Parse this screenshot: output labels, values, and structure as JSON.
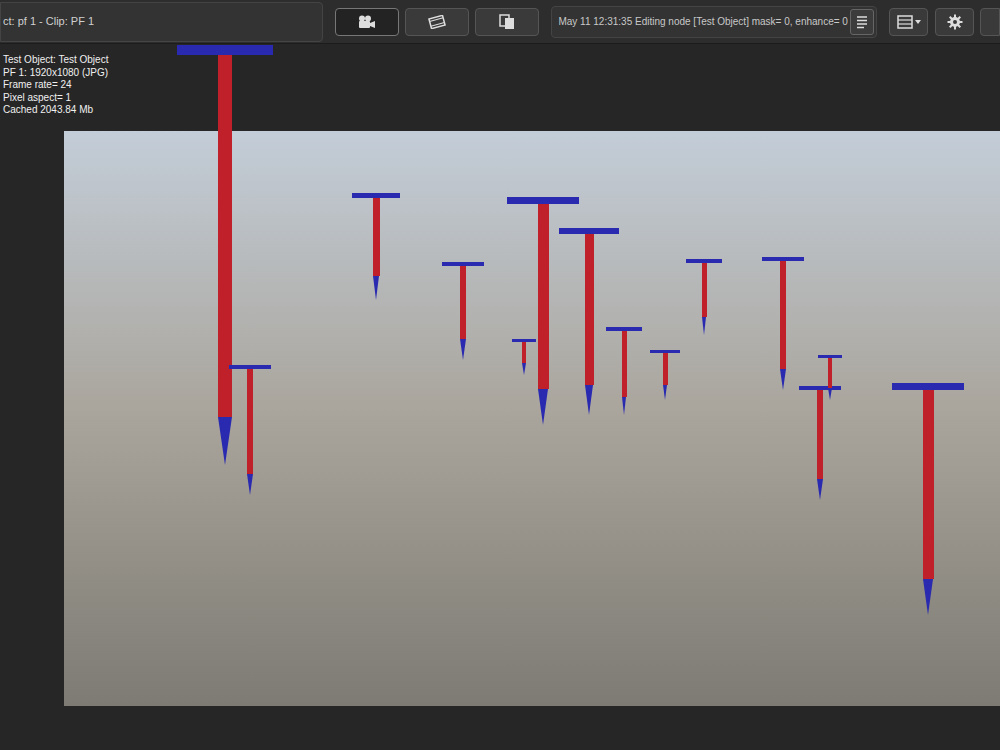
{
  "header": {
    "title": "ct: pf 1 - Clip: PF 1",
    "status": "May 11 12:31:35 Editing node [Test Object] mask= 0, enhance= 0"
  },
  "view_buttons": [
    {
      "kind": "camera",
      "selected": true
    },
    {
      "kind": "film",
      "selected": false
    },
    {
      "kind": "docs",
      "selected": false
    }
  ],
  "info": [
    "Test Object: Test Object",
    "PF 1: 1920x1080 (JPG)",
    "Frame rate= 24",
    "Pixel aspect= 1",
    "Cached 2043.84 Mb"
  ]
}
